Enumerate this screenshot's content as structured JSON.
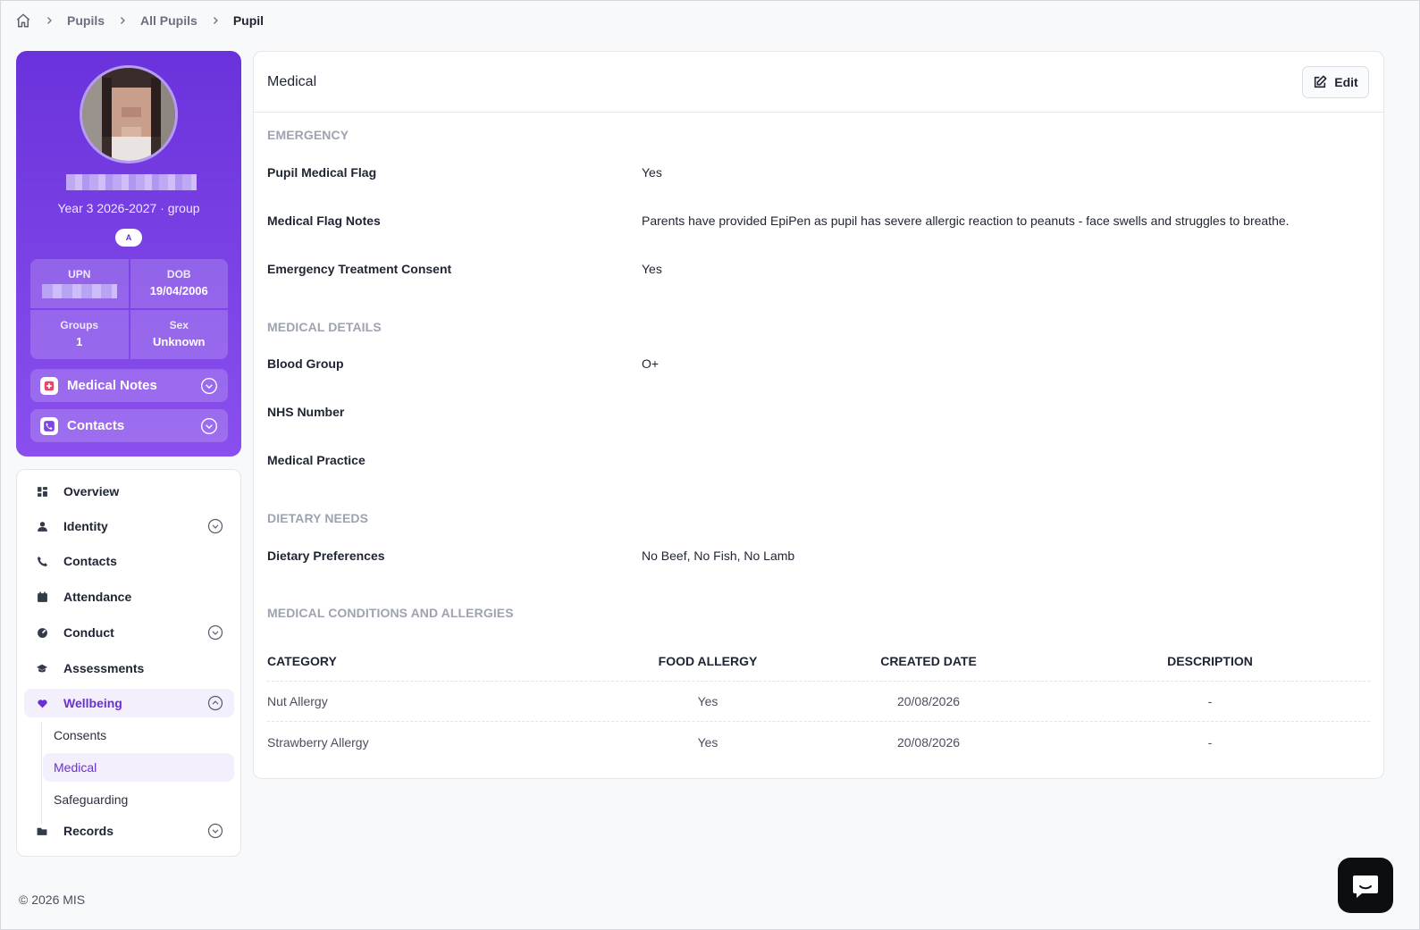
{
  "breadcrumb": {
    "items": [
      "Pupils",
      "All Pupils"
    ],
    "current": "Pupil"
  },
  "profile": {
    "year_group": "Year 3 2026-2027 · group",
    "badge": "A",
    "stats": {
      "upn_label": "UPN",
      "dob_label": "DOB",
      "dob_value": "19/04/2006",
      "groups_label": "Groups",
      "groups_value": "1",
      "sex_label": "Sex",
      "sex_value": "Unknown"
    },
    "accordions": {
      "medical_notes": "Medical Notes",
      "contacts": "Contacts"
    }
  },
  "nav": {
    "overview": "Overview",
    "identity": "Identity",
    "contacts": "Contacts",
    "attendance": "Attendance",
    "conduct": "Conduct",
    "assessments": "Assessments",
    "wellbeing": "Wellbeing",
    "wellbeing_sub": {
      "consents": "Consents",
      "medical": "Medical",
      "safeguarding": "Safeguarding"
    },
    "records": "Records"
  },
  "footer": "© 2026 MIS",
  "panel": {
    "title": "Medical",
    "edit_label": "Edit",
    "emergency": {
      "section": "EMERGENCY",
      "flag_label": "Pupil Medical Flag",
      "flag_value": "Yes",
      "notes_label": "Medical Flag Notes",
      "notes_value": "Parents have provided EpiPen as pupil has severe allergic reaction to peanuts - face swells and struggles to breathe.",
      "consent_label": "Emergency Treatment Consent",
      "consent_value": "Yes"
    },
    "medical_details": {
      "section": "MEDICAL DETAILS",
      "blood_label": "Blood Group",
      "blood_value": "O+",
      "nhs_label": "NHS Number",
      "practice_label": "Medical Practice"
    },
    "dietary": {
      "section": "DIETARY NEEDS",
      "prefs_label": "Dietary Preferences",
      "prefs_value": "No Beef, No Fish, No Lamb"
    },
    "conditions": {
      "section": "MEDICAL CONDITIONS AND ALLERGIES",
      "columns": [
        "CATEGORY",
        "FOOD ALLERGY",
        "CREATED DATE",
        "DESCRIPTION"
      ],
      "rows": [
        [
          "Nut Allergy",
          "Yes",
          "20/08/2026",
          "-"
        ],
        [
          "Strawberry Allergy",
          "Yes",
          "20/08/2026",
          "-"
        ]
      ]
    }
  },
  "icons": {
    "home": "home-icon",
    "chevron": "chevron-right-icon",
    "edit": "edit-icon",
    "chat": "chat-icon"
  },
  "colors": {
    "brand": "#6a32db",
    "active_bg": "#f3effd",
    "active_text": "#6b2fd6"
  }
}
